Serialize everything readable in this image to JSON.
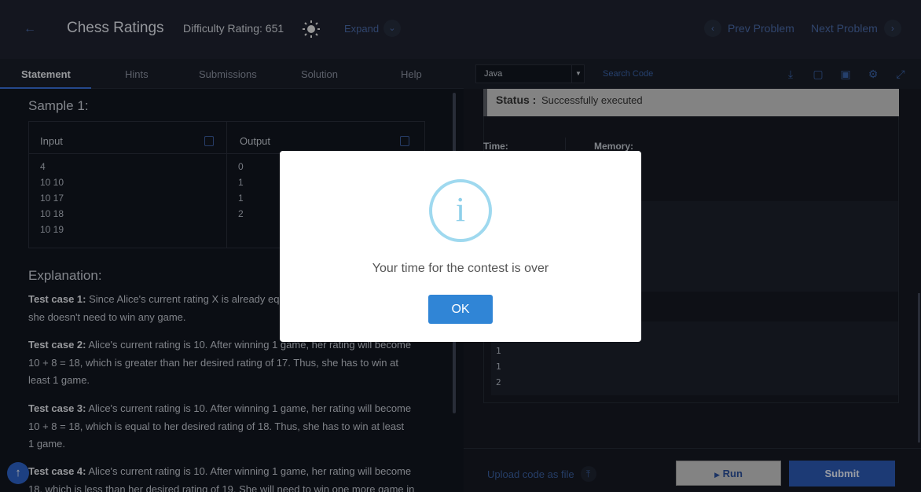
{
  "header": {
    "title": "Chess Ratings",
    "difficulty": "Difficulty Rating: 651",
    "expand_label": "Expand",
    "prev_label": "Prev Problem",
    "next_label": "Next Problem"
  },
  "tabs": [
    {
      "label": "Statement",
      "active": true
    },
    {
      "label": "Hints"
    },
    {
      "label": "Submissions"
    },
    {
      "label": "Solution"
    },
    {
      "label": "Help"
    }
  ],
  "statement": {
    "sample_title": "Sample 1:",
    "input_label": "Input",
    "output_label": "Output",
    "input_lines": [
      "4",
      "10 10",
      "10 17",
      "10 18",
      "10 19"
    ],
    "output_lines": [
      "0",
      "1",
      "1",
      "2"
    ],
    "explanation_title": "Explanation:",
    "cases": [
      {
        "label": "Test case 1:",
        "text": "Since Alice's current rating X is already eq",
        "text2": "she doesn't need to win any game."
      },
      {
        "label": "Test case 2:",
        "text": "Alice's current rating is 10. After winning 1 game, her rating will become",
        "text2": "10 + 8 = 18, which is greater than her desired rating of 17. Thus, she has to win at",
        "text3": "least 1 game."
      },
      {
        "label": "Test case 3:",
        "text": "Alice's current rating is 10. After winning 1 game, her rating will become",
        "text2": "10 + 8 = 18, which is equal to her desired rating of 18. Thus, she has to win at least",
        "text3": "1 game."
      },
      {
        "label": "Test case 4:",
        "text": "Alice's current rating is 10. After winning 1 game, her rating will become",
        "text2": "18, which is less than her desired rating of 19. She will need to win one more game in"
      }
    ]
  },
  "editor": {
    "language": "Java",
    "search_label": "Search Code",
    "status_label": "Status :",
    "status_value": "Successfully executed",
    "time_label": "Time:",
    "memory_label": "Memory:",
    "output_lines": [
      "1",
      "1",
      "2"
    ],
    "upload_label": "Upload code as file",
    "run_label": "Run",
    "submit_label": "Submit"
  },
  "modal": {
    "icon": "i",
    "message": "Your time for the contest is over",
    "ok_label": "OK"
  },
  "colors": {
    "accent": "#3085d6",
    "info": "#9fd9ef"
  }
}
